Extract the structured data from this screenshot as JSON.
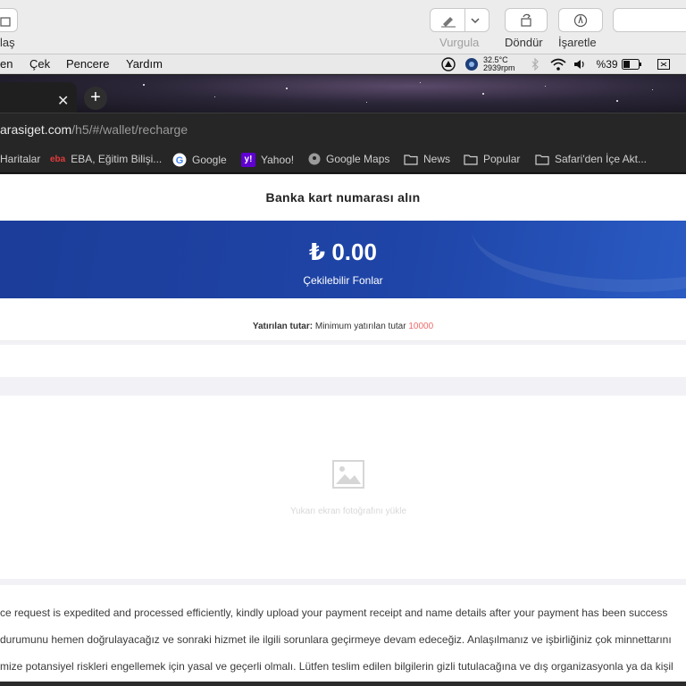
{
  "preview_toolbar": {
    "left_label": "laş",
    "highlight_label": "Vurgula",
    "rotate_label": "Döndür",
    "markup_label": "İşaretle"
  },
  "menubar": {
    "items": [
      "en",
      "Çek",
      "Pencere",
      "Yardım"
    ],
    "temp": "32.5°C",
    "rpm": "2939rpm",
    "battery": "%39"
  },
  "browser": {
    "url_host": "arasiget.com",
    "url_path": "/h5/#/wallet/recharge",
    "bookmarks": [
      {
        "label": "Haritalar",
        "icon": "maps-icon"
      },
      {
        "label": "EBA, Eğitim Bilişi...",
        "icon": "eba-icon"
      },
      {
        "label": "Google",
        "icon": "google-icon"
      },
      {
        "label": "Yahoo!",
        "icon": "yahoo-icon"
      },
      {
        "label": "Google Maps",
        "icon": "google-maps-icon"
      },
      {
        "label": "News",
        "icon": "folder-icon"
      },
      {
        "label": "Popular",
        "icon": "folder-icon"
      },
      {
        "label": "Safari'den İçe Akt...",
        "icon": "folder-icon"
      }
    ]
  },
  "page": {
    "title": "Banka kart numarası alın",
    "balance_amount": "₺ 0.00",
    "balance_caption": "Çekilebilir Fonlar",
    "deposit_label": "Yatırılan tutar:",
    "deposit_hint": "Minimum yatırılan tutar",
    "deposit_min": "10000",
    "upload_hint": "Yukarı ekran fotoğrafını yükle",
    "notes": [
      "ce request is expedited and processed efficiently, kindly upload your payment receipt and name details after your payment has been success",
      "durumunu hemen doğrulayacağız ve sonraki hizmet ile ilgili sorunlara geçirmeye devam edeceğiz. Anlaşılmanız ve işbirliğiniz çok minnettarını",
      "mize potansiyel riskleri engellemek için yasal ve geçerli olmalı. Lütfen teslim edilen bilgilerin gizli tutulacağına ve dış organizasyonla ya da kişil"
    ]
  },
  "colors": {
    "balance_blue": "#1f45a8",
    "min_amount_red": "#ef6a6a"
  }
}
